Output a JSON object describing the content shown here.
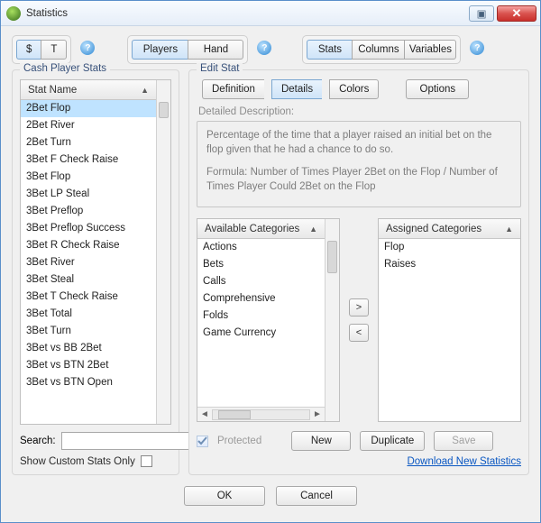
{
  "window": {
    "title": "Statistics"
  },
  "toolbar": {
    "dollar": "$",
    "t": "T",
    "players": "Players",
    "hand": "Hand",
    "stats": "Stats",
    "columns": "Columns",
    "variables": "Variables"
  },
  "left": {
    "legend": "Cash Player Stats",
    "header": "Stat Name",
    "items": [
      "2Bet Flop",
      "2Bet River",
      "2Bet Turn",
      "3Bet F Check Raise",
      "3Bet Flop",
      "3Bet LP Steal",
      "3Bet Preflop",
      "3Bet Preflop Success",
      "3Bet R Check Raise",
      "3Bet River",
      "3Bet Steal",
      "3Bet T Check Raise",
      "3Bet Total",
      "3Bet Turn",
      "3Bet vs BB 2Bet",
      "3Bet vs BTN 2Bet",
      "3Bet vs BTN Open"
    ],
    "search_label": "Search:",
    "search_value": "",
    "custom_label": "Show Custom Stats Only"
  },
  "right": {
    "legend": "Edit Stat",
    "tabs": {
      "definition": "Definition",
      "details": "Details",
      "colors": "Colors",
      "options": "Options"
    },
    "desc_label": "Detailed Description:",
    "desc_text1": "Percentage of the time that a player raised an initial bet on the flop given that he had a chance to do so.",
    "desc_text2": "Formula: Number of Times Player 2Bet on the Flop / Number of Times Player Could 2Bet on the Flop",
    "avail_header": "Available Categories",
    "avail_items": [
      "Actions",
      "Bets",
      "Calls",
      "Comprehensive",
      "Folds",
      "Game Currency"
    ],
    "assigned_header": "Assigned Categories",
    "assigned_items": [
      "Flop",
      "Raises"
    ],
    "move_right": ">",
    "move_left": "<",
    "protected": "Protected",
    "new": "New",
    "duplicate": "Duplicate",
    "save": "Save",
    "link": "Download New Statistics"
  },
  "footer": {
    "ok": "OK",
    "cancel": "Cancel"
  }
}
